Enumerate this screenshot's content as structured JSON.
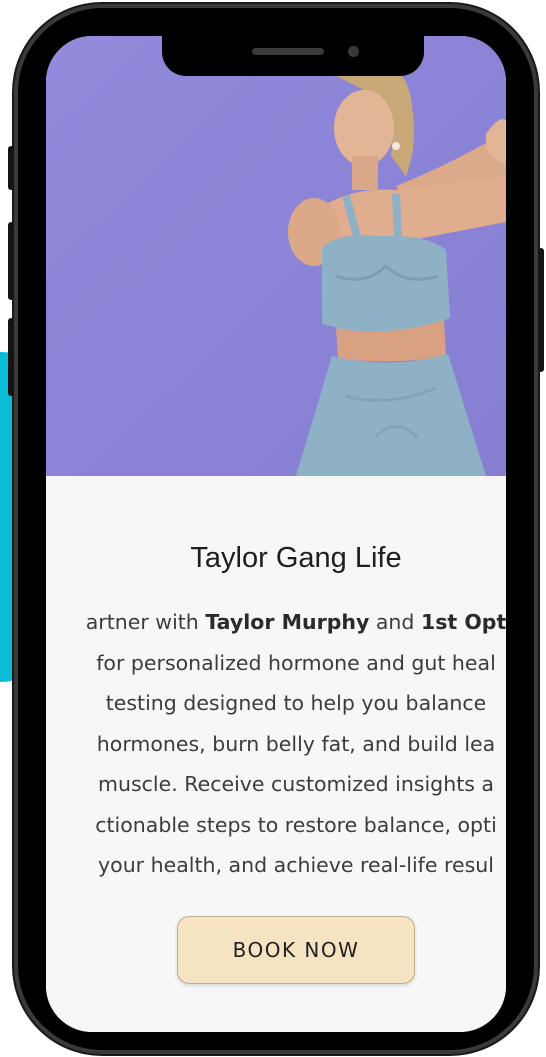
{
  "colors": {
    "hero_background": "#8e86d8",
    "accent": "#0bbcd6",
    "button_background": "#f5e3c1",
    "button_border": "#bfae90"
  },
  "hero": {
    "image": "woman-fitness-stretch-photo"
  },
  "card": {
    "title": "Taylor Gang Life",
    "body": {
      "line1_pre": "artner with ",
      "line1_bold1": "Taylor Murphy",
      "line1_mid": " and ",
      "line1_bold2": "1st Opt",
      "line2": "for personalized hormone and gut heal",
      "line3": "testing designed to help you balance",
      "line4": "hormones, burn belly fat, and build lea",
      "line5": "muscle. Receive customized insights a",
      "line6": "ctionable steps to restore balance, opti",
      "line7": "your health, and achieve real-life resul"
    },
    "button_label": "BOOK NOW"
  }
}
